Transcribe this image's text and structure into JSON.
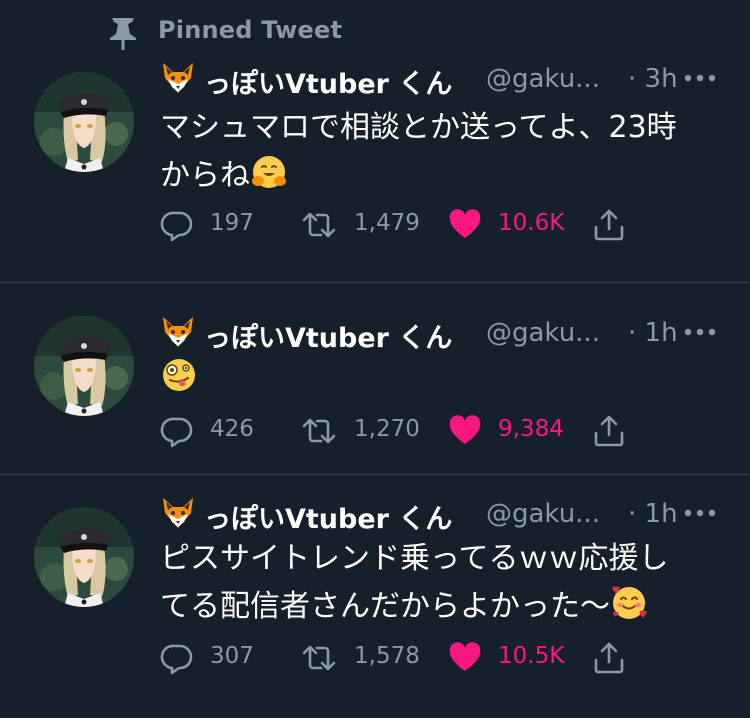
{
  "pinned": {
    "label": "Pinned Tweet"
  },
  "tweets": [
    {
      "name": "っぽいVtuber くん",
      "handle": "@gaku...",
      "time": "· 3h",
      "text_line1": "マシュマロで相談とか送ってよ、23時",
      "text_line2": "からね",
      "emoji": "hugging-face",
      "replies": "197",
      "retweets": "1,479",
      "likes": "10.6K",
      "liked": true
    },
    {
      "name": "っぽいVtuber くん",
      "handle": "@gaku...",
      "time": "· 1h",
      "text_line1": "",
      "text_line2": "",
      "emoji": "zany-face",
      "replies": "426",
      "retweets": "1,270",
      "likes": "9,384",
      "liked": true
    },
    {
      "name": "っぽいVtuber くん",
      "handle": "@gaku...",
      "time": "· 1h",
      "text_line1": "ピスサイトレンド乗ってるｗｗ応援し",
      "text_line2": "てる配信者さんだからよかった～",
      "emoji": "smiling-face-with-hearts",
      "replies": "307",
      "retweets": "1,578",
      "likes": "10.5K",
      "liked": true
    }
  ],
  "colors": {
    "background": "#15202b",
    "secondary_text": "#8b98a5",
    "like_pink": "#f91880",
    "divider": "#38444d"
  },
  "icons": [
    "pin-icon",
    "fox-emoji-icon",
    "more-icon",
    "reply-icon",
    "retweet-icon",
    "like-heart-icon",
    "share-icon"
  ]
}
